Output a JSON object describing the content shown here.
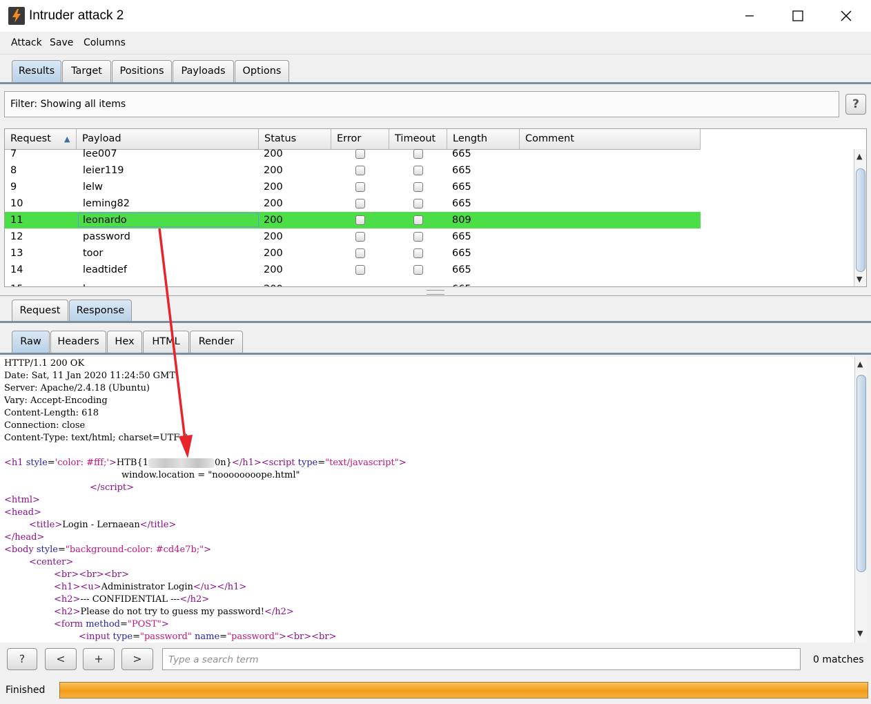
{
  "window": {
    "title": "Intruder attack 2",
    "controls": [
      "minimize",
      "maximize",
      "close"
    ]
  },
  "menu": [
    "Attack",
    "Save",
    "Columns"
  ],
  "main_tabs": [
    {
      "label": "Results",
      "active": true
    },
    {
      "label": "Target",
      "active": false
    },
    {
      "label": "Positions",
      "active": false
    },
    {
      "label": "Payloads",
      "active": false
    },
    {
      "label": "Options",
      "active": false
    }
  ],
  "filter": {
    "text": "Filter: Showing all items",
    "help": "?"
  },
  "results_table": {
    "columns": [
      "Request",
      "Payload",
      "Status",
      "Error",
      "Timeout",
      "Length",
      "Comment"
    ],
    "sort_indicator": "▲",
    "rows": [
      {
        "request": "7",
        "payload": "lee007",
        "status": "200",
        "length": "665",
        "selected": false
      },
      {
        "request": "8",
        "payload": "leier119",
        "status": "200",
        "length": "665",
        "selected": false
      },
      {
        "request": "9",
        "payload": "lelw",
        "status": "200",
        "length": "665",
        "selected": false
      },
      {
        "request": "10",
        "payload": "leming82",
        "status": "200",
        "length": "665",
        "selected": false
      },
      {
        "request": "11",
        "payload": "leonardo",
        "status": "200",
        "length": "809",
        "selected": true
      },
      {
        "request": "12",
        "payload": "password",
        "status": "200",
        "length": "665",
        "selected": false
      },
      {
        "request": "13",
        "payload": "toor",
        "status": "200",
        "length": "665",
        "selected": false
      },
      {
        "request": "14",
        "payload": "leadtidef",
        "status": "200",
        "length": "665",
        "selected": false
      }
    ],
    "highlight_color": "#4cde46"
  },
  "detail_tabs": [
    {
      "label": "Request",
      "active": false
    },
    {
      "label": "Response",
      "active": true
    }
  ],
  "view_tabs": [
    {
      "label": "Raw",
      "active": true
    },
    {
      "label": "Headers",
      "active": false
    },
    {
      "label": "Hex",
      "active": false
    },
    {
      "label": "HTML",
      "active": false
    },
    {
      "label": "Render",
      "active": false
    }
  ],
  "response_raw": {
    "headers": [
      "HTTP/1.1 200 OK",
      "Date: Sat, 11 Jan 2020 11:24:50 GMT",
      "Server: Apache/2.4.18 (Ubuntu)",
      "Vary: Accept-Encoding",
      "Content-Length: 618",
      "Connection: close",
      "Content-Type: text/html; charset=UTF-8"
    ],
    "body": {
      "flag_prefix": "HTB{1",
      "flag_suffix": "0n}",
      "color_value": "'color: #fff;'",
      "script_type": "\"text/javascript\"",
      "window_location": "window.location = \"noooooooope.html\"",
      "title_text": "Login - Lernaean",
      "body_style": "\"background-color: #cd4e7b;\"",
      "br_line": "<br><br><br>",
      "h1_text": "Administrator Login",
      "h2a_text": "--- CONFIDENTIAL ---",
      "h2b_text": "Please do not try to guess my password!",
      "form_method": "\"POST\"",
      "input_type": "\"password\"",
      "input_name": "\"password\""
    }
  },
  "search": {
    "help": "?",
    "prev": "<",
    "add": "+",
    "next": ">",
    "placeholder": "Type a search term",
    "matches": "0 matches"
  },
  "status": {
    "text": "Finished",
    "progress_fraction": 1.0,
    "bar_color": "#f29d1c"
  },
  "annotation_arrow_color": "#e8232a"
}
